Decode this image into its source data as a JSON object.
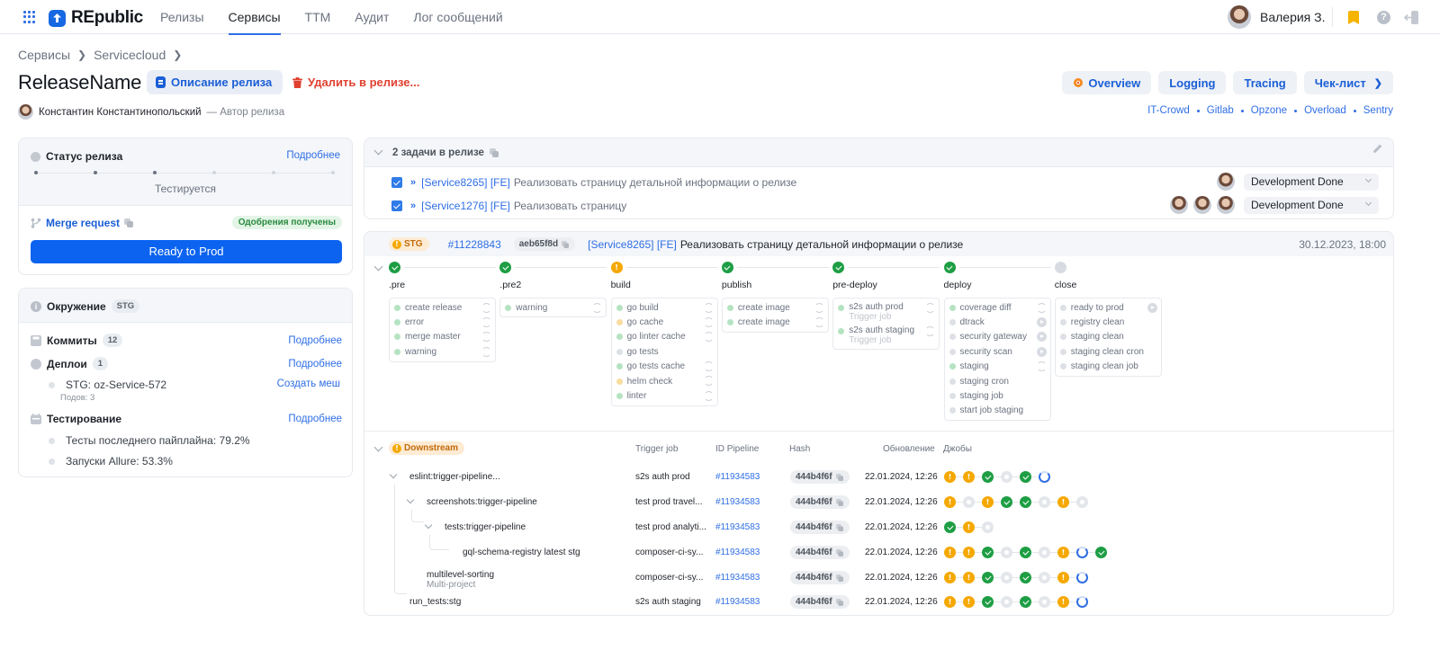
{
  "nav": {
    "app_name": "REpublic",
    "items": [
      {
        "label": "Релизы",
        "active": false
      },
      {
        "label": "Сервисы",
        "active": true
      },
      {
        "label": "ТТМ",
        "active": false
      },
      {
        "label": "Аудит",
        "active": false
      },
      {
        "label": "Лог сообщений",
        "active": false
      }
    ],
    "user_name": "Валерия З."
  },
  "breadcrumb": [
    "Сервисы",
    "Servicecloud"
  ],
  "page": {
    "title": "ReleaseName",
    "description_button": "Описание релиза",
    "delete_button": "Удалить в релизе...",
    "author_name": "Константин Константинопольский",
    "author_role": "— Автор релиза"
  },
  "right_buttons": [
    "Overview",
    "Logging",
    "Tracing",
    "Чек-лист"
  ],
  "external_links": [
    "IT-Crowd",
    "Gitlab",
    "Opzone",
    "Overload",
    "Sentry"
  ],
  "status_card": {
    "title": "Статус релиза",
    "more_link": "Подробнее",
    "steps_total": 6,
    "steps_done": 3,
    "current_status": "Тестируется",
    "merge_request_label": "Merge request",
    "approval_badge": "Одобрения получены",
    "ready_button": "Ready to Prod"
  },
  "env_card": {
    "title": "Окружение",
    "env_badge": "STG",
    "commits_label": "Коммиты",
    "commits_count": "12",
    "commits_link": "Подробнее",
    "deploys_label": "Деплои",
    "deploys_count": "1",
    "deploys_link": "Подробнее",
    "deploy_item": "STG: oz-Service-572",
    "deploy_pods": "Подов: 3",
    "deploy_action": "Создать меш",
    "testing_label": "Тестирование",
    "testing_link": "Подробнее",
    "test_last_pipeline": "Тесты последнего пайплайна: 79.2%",
    "allure_runs": "Запуски Allure: 53.3%"
  },
  "tasks": {
    "header": "2 задачи в релизе",
    "items": [
      {
        "key": "[Service8265] [FE]",
        "text": "Реализовать страницу детальной информации о релизе",
        "status": "Development Done",
        "assignees": 1
      },
      {
        "key": "[Service1276] [FE]",
        "text": "Реализовать страницу",
        "status": "Development Done",
        "assignees": 3
      }
    ]
  },
  "pipeline": {
    "env": "STG",
    "id": "#11228843",
    "hash": "aeb65f8d",
    "task_key": "[Service8265] [FE]",
    "task_text": "Реализовать страницу детальной информации о релизе",
    "date": "30.12.2023, 18:00",
    "stages": [
      {
        "name": ".pre",
        "status": "success",
        "jobs": [
          {
            "name": "create release",
            "status": "success",
            "action": "retry"
          },
          {
            "name": "error",
            "status": "success",
            "action": "retry"
          },
          {
            "name": "merge master",
            "status": "success",
            "action": "retry"
          },
          {
            "name": "warning",
            "status": "success",
            "action": "retry"
          }
        ]
      },
      {
        "name": ".pre2",
        "status": "success",
        "jobs": [
          {
            "name": "warning",
            "status": "success",
            "action": "retry"
          }
        ]
      },
      {
        "name": "build",
        "status": "warning",
        "jobs": [
          {
            "name": "go build",
            "status": "success",
            "action": "retry"
          },
          {
            "name": "go cache",
            "status": "warning",
            "action": "retry"
          },
          {
            "name": "go linter cache",
            "status": "success",
            "action": "retry"
          },
          {
            "name": "go tests",
            "status": "pending",
            "action": ""
          },
          {
            "name": "go tests cache",
            "status": "success",
            "action": "retry"
          },
          {
            "name": "helm check",
            "status": "warning",
            "action": "retry"
          },
          {
            "name": "linter",
            "status": "success",
            "action": "retry"
          }
        ]
      },
      {
        "name": "publish",
        "status": "success",
        "jobs": [
          {
            "name": "create image",
            "status": "success",
            "action": "retry"
          },
          {
            "name": "create image",
            "status": "success",
            "action": "retry"
          }
        ]
      },
      {
        "name": "pre-deploy",
        "status": "success",
        "jobs": [
          {
            "name": "s2s auth prod",
            "sub": "Trigger job",
            "status": "success",
            "action": "retry"
          },
          {
            "name": "s2s auth staging",
            "sub": "Trigger job",
            "status": "success",
            "action": "retry"
          }
        ]
      },
      {
        "name": "deploy",
        "status": "success",
        "jobs": [
          {
            "name": "coverage diff",
            "status": "success",
            "action": "retry"
          },
          {
            "name": "dtrack",
            "status": "pending",
            "action": "play"
          },
          {
            "name": "security gateway",
            "status": "pending",
            "action": "play"
          },
          {
            "name": "security scan",
            "status": "pending",
            "action": "play"
          },
          {
            "name": "staging",
            "status": "success",
            "action": "retry"
          },
          {
            "name": "staging cron",
            "status": "pending",
            "action": ""
          },
          {
            "name": "staging job",
            "status": "pending",
            "action": ""
          },
          {
            "name": "start job staging",
            "status": "pending",
            "action": ""
          }
        ]
      },
      {
        "name": "close",
        "status": "pending",
        "jobs": [
          {
            "name": "ready to prod",
            "status": "pending",
            "action": "play"
          },
          {
            "name": "registry clean",
            "status": "pending",
            "action": ""
          },
          {
            "name": "staging clean",
            "status": "pending",
            "action": ""
          },
          {
            "name": "staging clean cron",
            "status": "pending",
            "action": ""
          },
          {
            "name": "staging clean job",
            "status": "pending",
            "action": ""
          }
        ]
      }
    ]
  },
  "downstream": {
    "label": "Downstream",
    "columns": [
      "Trigger job",
      "ID Pipeline",
      "Hash",
      "Обновление",
      "Джобы"
    ],
    "rows": [
      {
        "name": "eslint:trigger-pipeline...",
        "sub": "",
        "level": 0,
        "trigger": "s2s auth prod",
        "id": "#11934583",
        "hash": "444b4f6f",
        "updated": "22.01.2024, 12:26",
        "jobs": [
          "warning",
          "warning",
          "success",
          "skipped",
          "success",
          "running"
        ]
      },
      {
        "name": "screenshots:trigger-pipeline",
        "sub": "",
        "level": 1,
        "trigger": "test prod travel...",
        "id": "#11934583",
        "hash": "444b4f6f",
        "updated": "22.01.2024, 12:26",
        "jobs": [
          "warning",
          "skipped",
          "warning",
          "success",
          "success",
          "skipped",
          "warning",
          "skipped"
        ]
      },
      {
        "name": "tests:trigger-pipeline",
        "sub": "",
        "level": 2,
        "trigger": "test prod analyti...",
        "id": "#11934583",
        "hash": "444b4f6f",
        "updated": "22.01.2024, 12:26",
        "jobs": [
          "success",
          "warning",
          "skipped"
        ]
      },
      {
        "name": "gql-schema-registry latest stg",
        "sub": "",
        "level": 3,
        "trigger": "composer-ci-sy...",
        "id": "#11934583",
        "hash": "444b4f6f",
        "updated": "22.01.2024, 12:26",
        "jobs": [
          "warning",
          "warning",
          "success",
          "skipped",
          "success",
          "skipped",
          "warning",
          "running",
          "success"
        ]
      },
      {
        "name": "multilevel-sorting",
        "sub": "Multi-project",
        "level": 1,
        "trigger": "composer-ci-sy...",
        "id": "#11934583",
        "hash": "444b4f6f",
        "updated": "22.01.2024, 12:26",
        "jobs": [
          "warning",
          "warning",
          "success",
          "skipped",
          "success",
          "skipped",
          "warning",
          "running"
        ]
      },
      {
        "name": "run_tests:stg",
        "sub": "",
        "level": 0,
        "trigger": "s2s auth staging",
        "id": "#11934583",
        "hash": "444b4f6f",
        "updated": "22.01.2024, 12:26",
        "jobs": [
          "warning",
          "warning",
          "success",
          "skipped",
          "success",
          "skipped",
          "warning",
          "running"
        ]
      }
    ]
  },
  "colors": {
    "accent": "#2f6ee5",
    "primary_button": "#0b63f0",
    "success": "#1e9e44",
    "warning": "#f5a800",
    "danger": "#e0402f",
    "pending": "#d8dce2"
  }
}
